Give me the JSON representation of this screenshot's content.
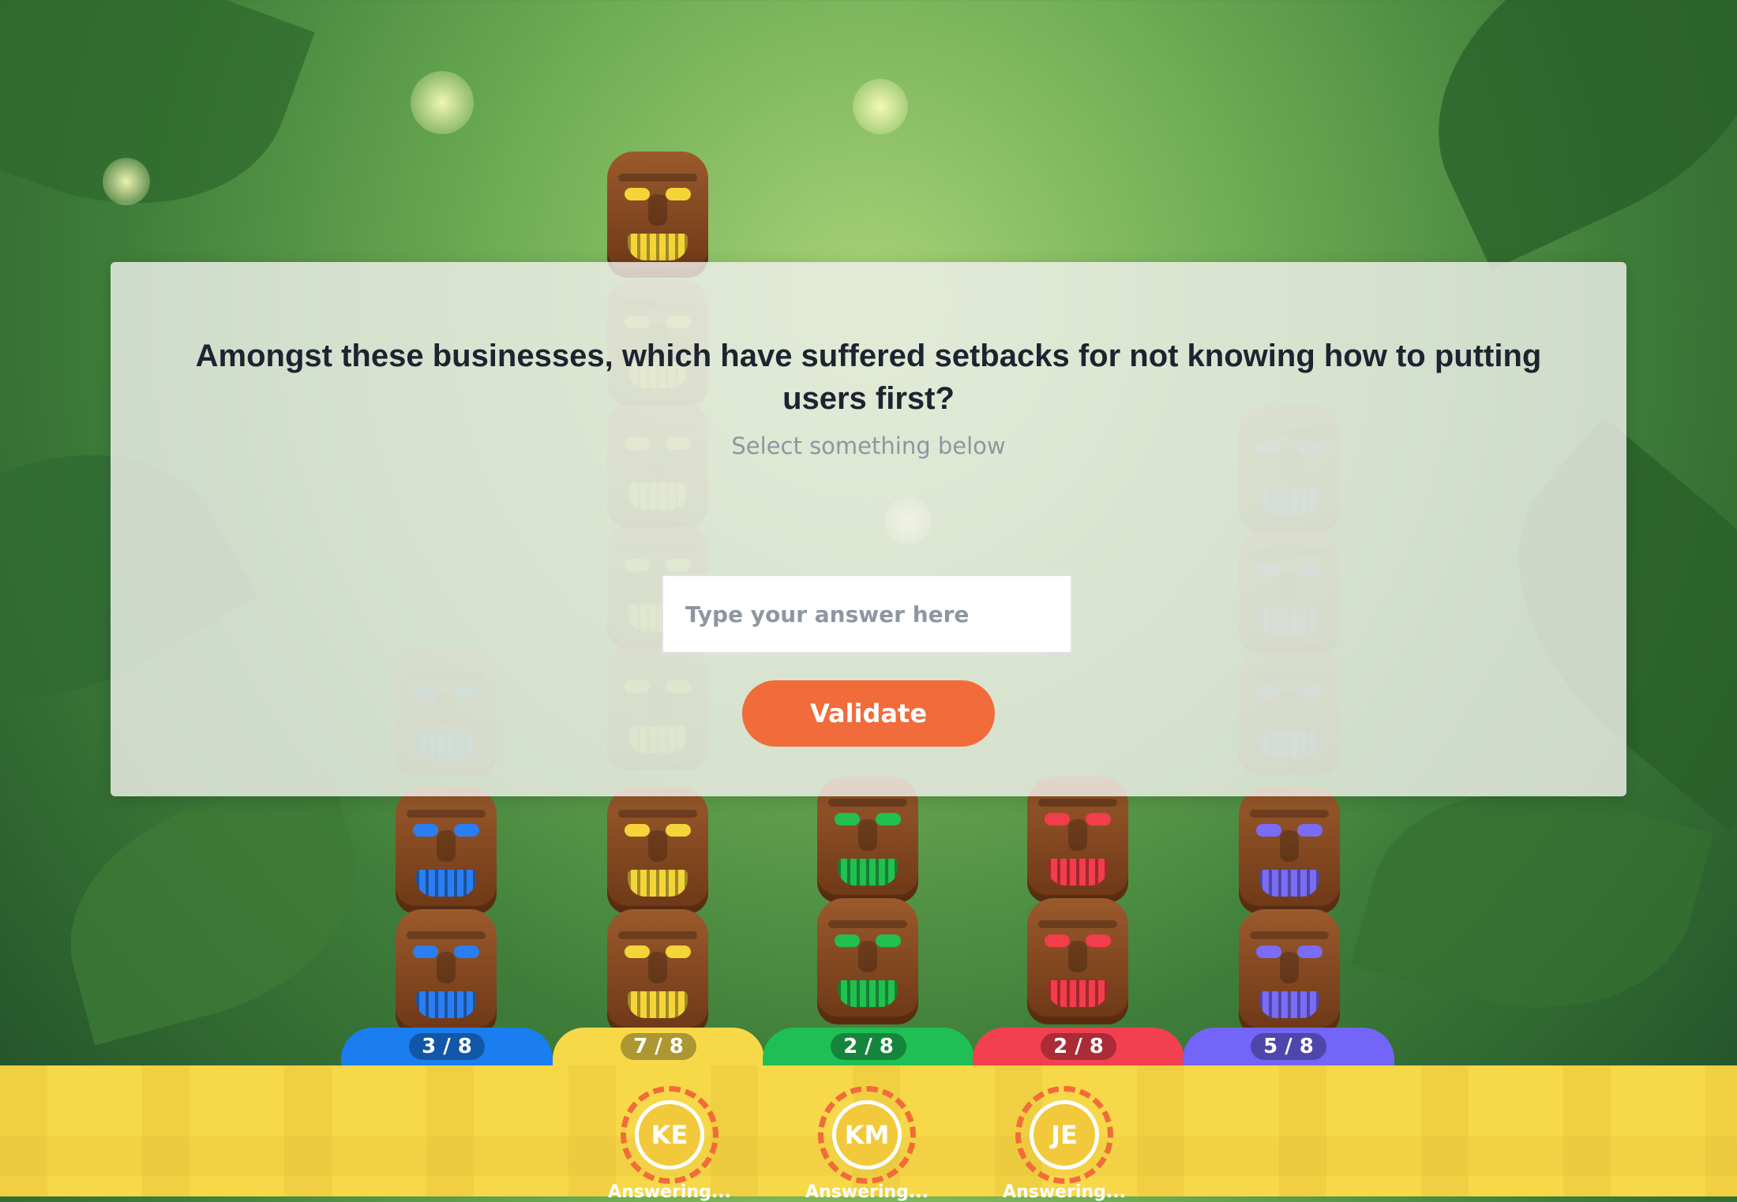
{
  "question": {
    "text": "Amongst these businesses, which have suffered setbacks for not knowing how to putting users first?",
    "hint": "Select something below"
  },
  "answer": {
    "placeholder": "Type your answer here",
    "value": ""
  },
  "validate_label": "Validate",
  "teams": [
    {
      "score": "3 / 8",
      "color": "#1a7df0",
      "accent": "#2b7ef2"
    },
    {
      "score": "7 / 8",
      "color": "#f7d848",
      "accent": "#f5d43a"
    },
    {
      "score": "2 / 8",
      "color": "#1fbf55",
      "accent": "#21c04f"
    },
    {
      "score": "2 / 8",
      "color": "#f2404f",
      "accent": "#f23d4a"
    },
    {
      "score": "5 / 8",
      "color": "#7265f7",
      "accent": "#7a6cf5"
    }
  ],
  "players": [
    {
      "initials": "KE",
      "status": "Answering..."
    },
    {
      "initials": "KM",
      "status": "Answering..."
    },
    {
      "initials": "JE",
      "status": "Answering..."
    }
  ]
}
